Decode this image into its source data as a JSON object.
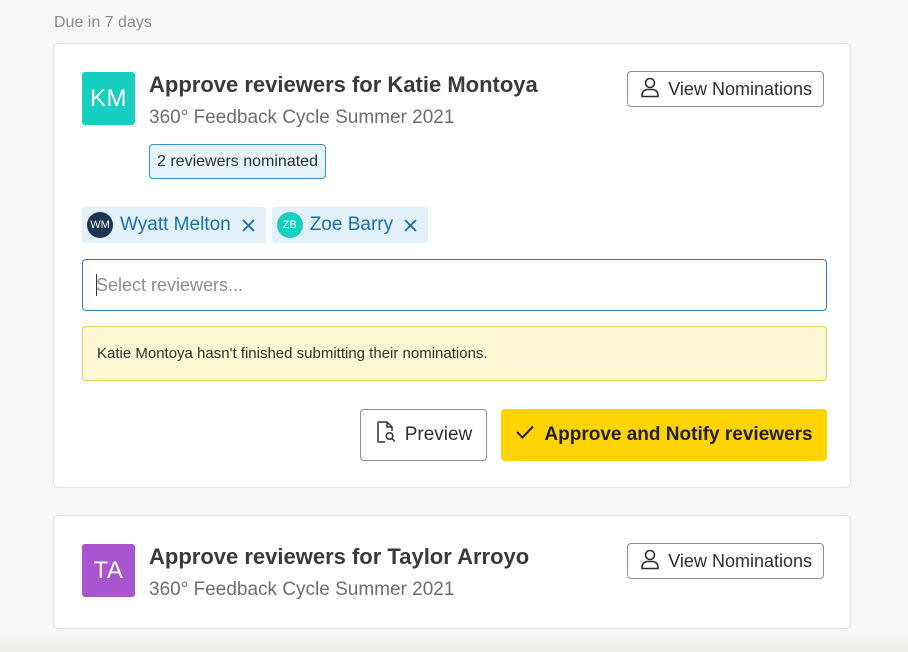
{
  "section": {
    "label": "Due in 7 days"
  },
  "colors": {
    "accent_blue": "#1a6fb0",
    "approve_yellow": "#ffd400",
    "km_teal": "#17cfc1",
    "ta_purple": "#a855cf"
  },
  "cards": [
    {
      "avatar_initials": "KM",
      "title": "Approve reviewers for Katie Montoya",
      "subtitle": "360° Feedback Cycle Summer 2021",
      "view_button": {
        "label": "View Nominations",
        "icon": "user-icon"
      },
      "badge": "2 reviewers nominated",
      "reviewers": [
        {
          "initials": "WM",
          "name": "Wyatt Melton",
          "color": "#1b3553"
        },
        {
          "initials": "ZB",
          "name": "Zoe Barry",
          "color": "#17cfc1"
        }
      ],
      "select": {
        "placeholder": "Select reviewers...",
        "value": ""
      },
      "warning": "Katie Montoya hasn't finished submitting their nominations.",
      "preview_button": {
        "label": "Preview",
        "icon": "document-search-icon"
      },
      "approve_button": {
        "label": "Approve and Notify reviewers",
        "icon": "check-icon"
      }
    },
    {
      "avatar_initials": "TA",
      "title": "Approve reviewers for Taylor Arroyo",
      "subtitle": "360° Feedback Cycle Summer 2021",
      "view_button": {
        "label": "View Nominations",
        "icon": "user-icon"
      }
    }
  ]
}
